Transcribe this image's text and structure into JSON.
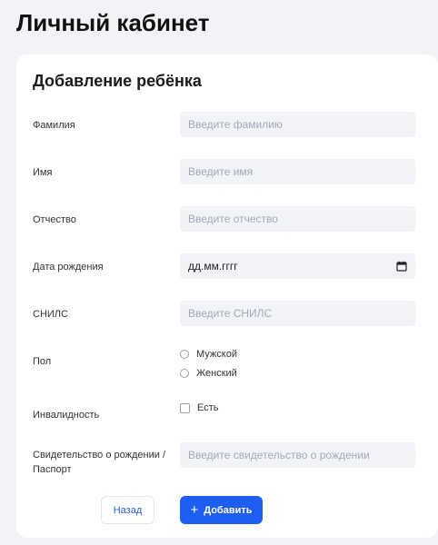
{
  "page": {
    "title": "Личный кабинет"
  },
  "form": {
    "title": "Добавление ребёнка",
    "fields": {
      "surname": {
        "label": "Фамилия",
        "placeholder": "Введите фамилию"
      },
      "name": {
        "label": "Имя",
        "placeholder": "Введите имя"
      },
      "patronymic": {
        "label": "Отчество",
        "placeholder": "Введите отчество"
      },
      "birthdate": {
        "label": "Дата рождения",
        "value": "дд.мм.гггг"
      },
      "snils": {
        "label": "СНИЛС",
        "placeholder": "Введите СНИЛС"
      },
      "gender": {
        "label": "Пол",
        "options": [
          "Мужской",
          "Женский"
        ]
      },
      "disability": {
        "label": "Инвалидность",
        "option": "Есть"
      },
      "document": {
        "label": "Свидетельство о рождении / Паспорт",
        "placeholder": "Введите свидетельство о рождении"
      }
    },
    "buttons": {
      "back": "Назад",
      "add": "Добавить"
    }
  },
  "icons": {
    "calendar": "calendar-icon",
    "add": "plus-icon"
  },
  "colors": {
    "primary": "#1f5ef2",
    "input_bg": "#f2f3f7",
    "page_bg": "#f2f3f6"
  }
}
